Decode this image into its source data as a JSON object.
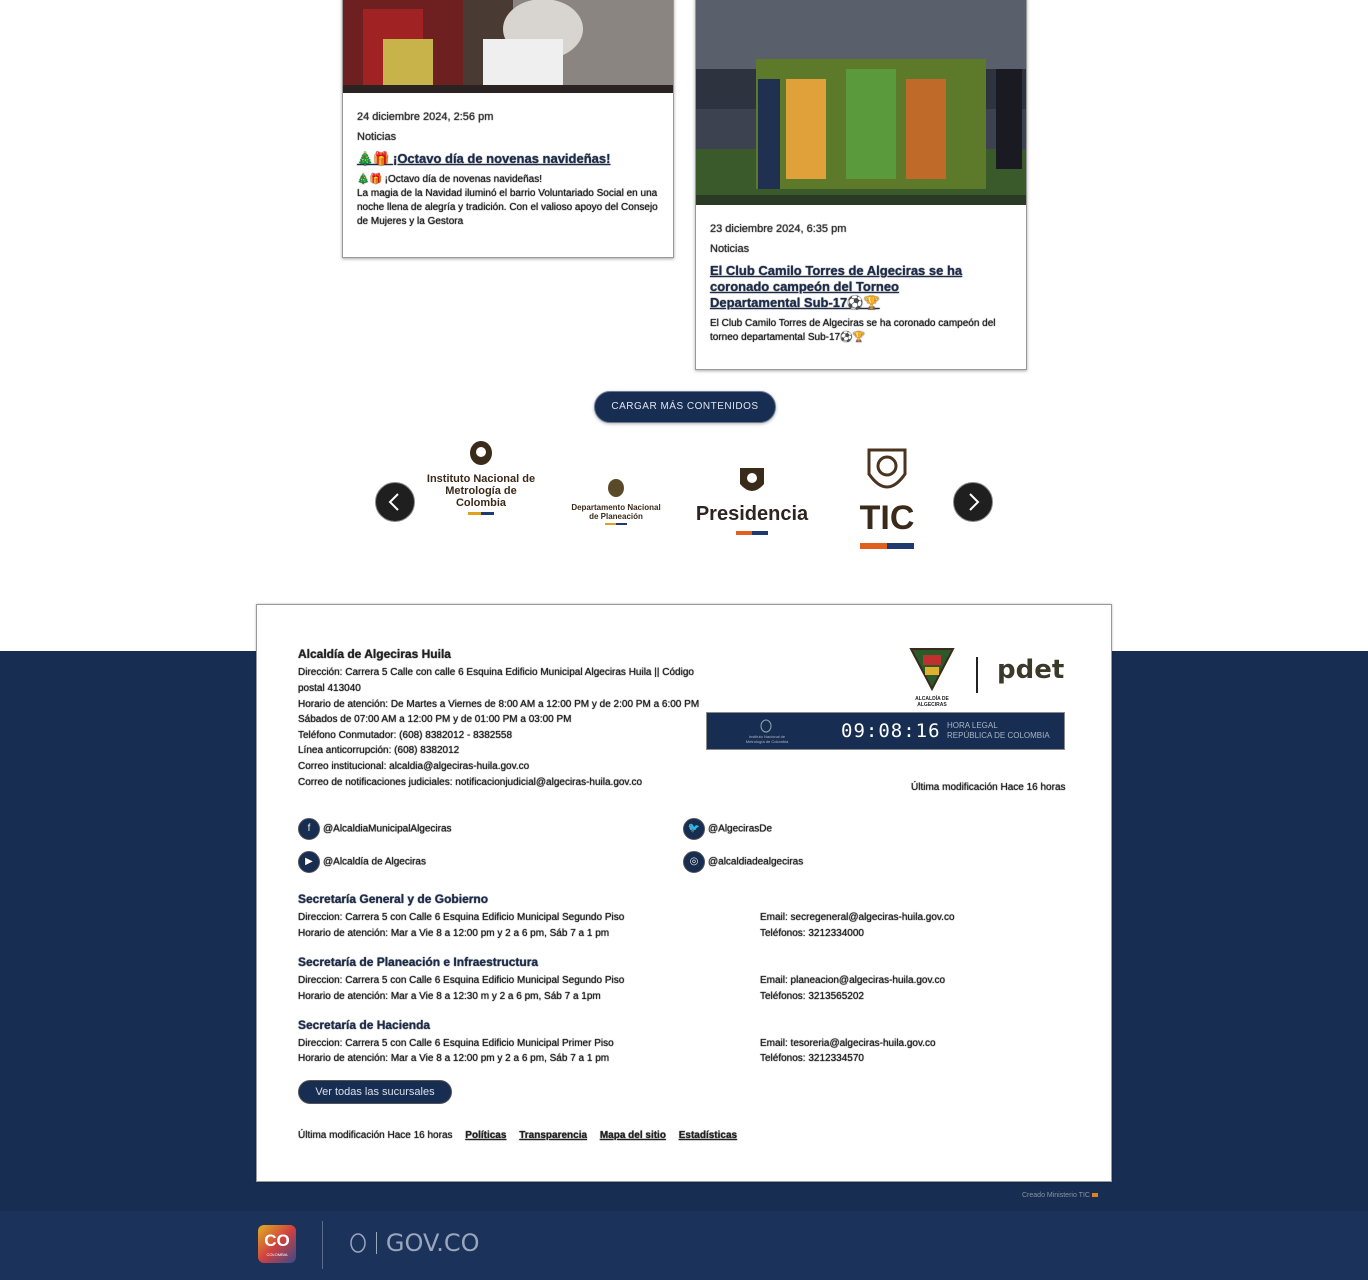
{
  "news": [
    {
      "date": "24 diciembre 2024, 2:56 pm",
      "category": "Noticias",
      "title": "🎄🎁 ¡Octavo día de novenas navideñas!",
      "excerpt": "🎄🎁 ¡Octavo día de novenas navideñas!\nLa magia de la Navidad iluminó el barrio Voluntariado Social en una noche llena de alegría y tradición. Con el valioso apoyo del Consejo de Mujeres y la Gestora"
    },
    {
      "date": "23 diciembre 2024, 6:35 pm",
      "category": "Noticias",
      "title": "El Club Camilo Torres de Algeciras se ha coronado campeón del Torneo Departamental Sub-17⚽🏆",
      "excerpt": "El Club Camilo Torres de Algeciras se ha coronado campeón del torneo departamental Sub-17⚽🏆"
    }
  ],
  "load_more_label": "CARGAR MÁS CONTENIDOS",
  "partners": {
    "inm": "Instituto Nacional de Metrología de Colombia",
    "dnp": "Departamento Nacional de Planeación",
    "presidencia": "Presidencia",
    "tic": "TIC"
  },
  "footer": {
    "org_name": "Alcaldía de Algeciras Huila",
    "contact_lines": [
      "Dirección: Carrera 5 Calle con calle 6 Esquina Edificio Municipal Algeciras Huila || Código",
      "postal 413040",
      "Horario de atención: De Martes a Viernes de 8:00 AM a 12:00 PM y de 2:00 PM a 6:00 PM",
      "Sábados de 07:00 AM a 12:00 PM y de 01:00 PM a 03:00 PM",
      "Teléfono Conmutador: (608) 8382012 - 8382558",
      "Línea anticorrupción: (608) 8382012",
      "Correo institucional: alcaldia@algeciras-huila.gov.co",
      "Correo de notificaciones judiciales: notificacionjudicial@algeciras-huila.gov.co"
    ],
    "last_modified": "Última modificación Hace 16 horas",
    "clock": {
      "time": "09:08:16",
      "label_1": "HORA LEGAL",
      "label_2": "REPÚBLICA DE COLOMBIA",
      "institute": "Instituto Nacional de Metrología de Colombia"
    },
    "logo_text": {
      "alcaldia": "ALCALDÍA DE ALGECIRAS",
      "pdet": "pdet"
    },
    "social": {
      "facebook": "@AlcaldiaMunicipalAlgeciras",
      "twitter": "@AlgecirasDe",
      "youtube": "@Alcaldía de Algeciras",
      "instagram": "@alcaldiadealgeciras"
    },
    "branches": [
      {
        "name": "Secretaría General y de Gobierno",
        "address": "Direccion: Carrera 5 con Calle 6 Esquina Edificio Municipal Segundo Piso",
        "hours": "Horario de atención: Mar a Vie 8 a 12:00 pm y 2 a 6 pm, Sáb 7 a 1 pm",
        "email": "Email: secregeneral@algeciras-huila.gov.co",
        "phone": "Teléfonos: 3212334000"
      },
      {
        "name": "Secretaría de Planeación e Infraestructura",
        "address": "Direccion: Carrera 5 con Calle 6 Esquina Edificio Municipal Segundo Piso",
        "hours": "Horario de atención: Mar a Vie 8 a 12:30 m y 2 a 6 pm, Sáb 7 a 1pm",
        "email": "Email: planeacion@algeciras-huila.gov.co",
        "phone": "Teléfonos: 3213565202"
      },
      {
        "name": "Secretaría de Hacienda",
        "address": "Direccion: Carrera 5 con Calle 6 Esquina Edificio Municipal Primer Piso",
        "hours": "Horario de atención: Mar a Vie 8 a 12:00 pm y 2 a 6 pm, Sáb 7 a 1 pm",
        "email": "Email: tesoreria@algeciras-huila.gov.co",
        "phone": "Teléfonos: 3212334570"
      }
    ],
    "branches_button": "Ver todas las sucursales",
    "bottom_links": {
      "last_modified": "Última modificación Hace 16 horas",
      "politicas": "Políticas",
      "transparencia": "Transparencia",
      "mapa": "Mapa del sitio",
      "estadisticas": "Estadísticas"
    }
  },
  "credit": "Creado Ministerio TIC",
  "gov_bar": {
    "co_badge": "CO",
    "co_sub": "COLOMBIA",
    "govco": "GOV.CO"
  },
  "colors": {
    "navy": "#172d52",
    "gov_bar": "#1b325a"
  }
}
